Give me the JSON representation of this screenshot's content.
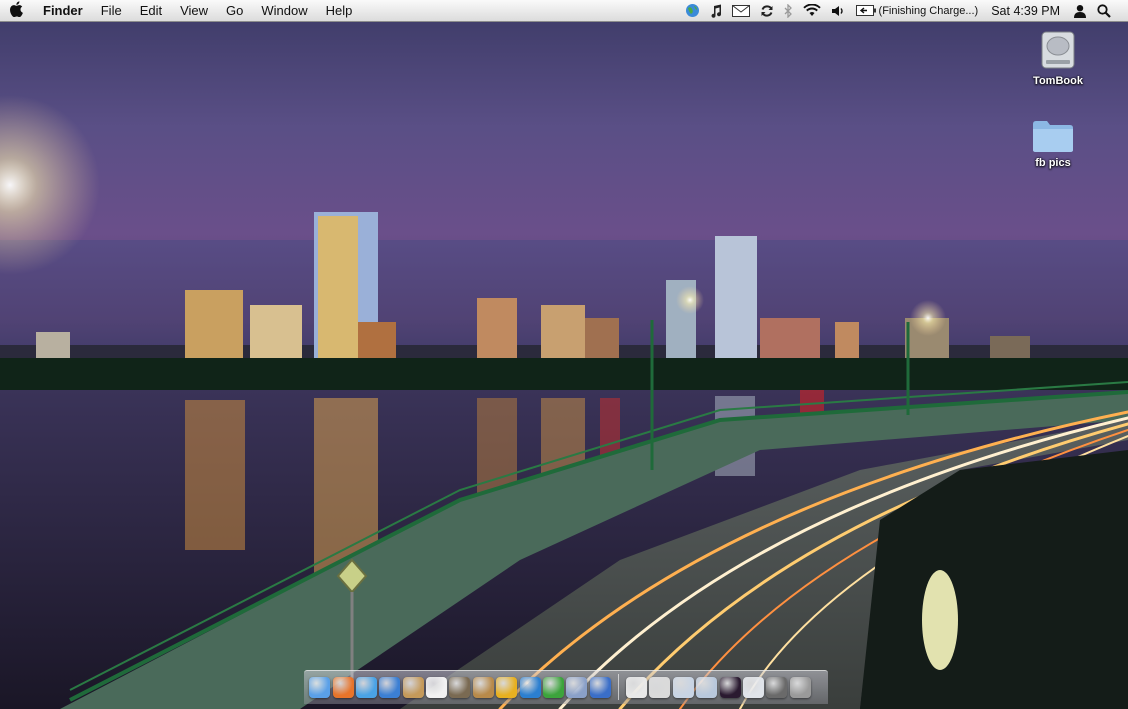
{
  "menubar": {
    "apple_menu": "",
    "app_name": "Finder",
    "menus": [
      "File",
      "Edit",
      "View",
      "Go",
      "Window",
      "Help"
    ],
    "status": {
      "battery_text": "(Finishing Charge...)",
      "clock": "Sat 4:39 PM"
    }
  },
  "desktop_icons": [
    {
      "label": "TomBook",
      "icon": "hard-drive-icon"
    },
    {
      "label": "fb pics",
      "icon": "folder-icon"
    }
  ],
  "dock": {
    "apps": [
      {
        "name": "finder-icon",
        "color": "#5aa0e8"
      },
      {
        "name": "firefox-icon",
        "color": "#e8742a"
      },
      {
        "name": "ichat-icon",
        "color": "#4aa3e6"
      },
      {
        "name": "itunes-icon",
        "color": "#3b7fd4"
      },
      {
        "name": "address-book-icon",
        "color": "#c59a5a"
      },
      {
        "name": "ical-icon",
        "color": "#f2f2f2"
      },
      {
        "name": "iphoto-icon",
        "color": "#7a6a52"
      },
      {
        "name": "preview-icon",
        "color": "#b88a4a"
      },
      {
        "name": "link-app-icon",
        "color": "#e8b020"
      },
      {
        "name": "word-icon",
        "color": "#2b7fd0"
      },
      {
        "name": "excel-icon",
        "color": "#3ca43c"
      },
      {
        "name": "mail-app-icon",
        "color": "#8aa0c8"
      },
      {
        "name": "safari-icon",
        "color": "#3a6ec8"
      }
    ],
    "docs": [
      {
        "name": "document-icon",
        "color": "#e8e8e8"
      },
      {
        "name": "document-icon",
        "color": "#dadada"
      },
      {
        "name": "window-thumbnail-icon",
        "color": "#c8d4e4"
      },
      {
        "name": "window-thumbnail-icon",
        "color": "#b8c8dc"
      },
      {
        "name": "album-art-icon",
        "color": "#2a1a30"
      },
      {
        "name": "document-icon",
        "color": "#e0e4ea"
      },
      {
        "name": "stack-icon",
        "color": "#6a6a6a"
      },
      {
        "name": "trash-icon",
        "color": "#9a9a9a"
      }
    ]
  }
}
